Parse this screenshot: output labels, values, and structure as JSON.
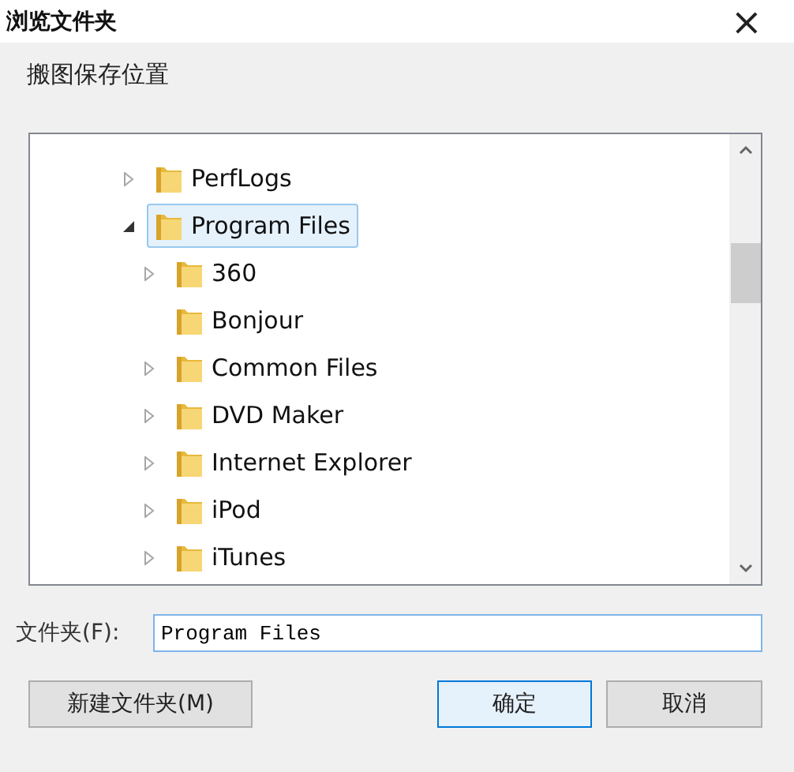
{
  "window": {
    "title": "浏览文件夹",
    "close": "×"
  },
  "description": "搬图保存位置",
  "tree": [
    {
      "label": "PerfLogs",
      "expandable": true,
      "selected": false
    },
    {
      "label": "Program Files",
      "expandable": true,
      "expanded": true,
      "selected": true,
      "children": [
        {
          "label": "360",
          "expandable": true,
          "selected": false
        },
        {
          "label": "Bonjour",
          "expandable": false,
          "selected": false
        },
        {
          "label": "Common Files",
          "expandable": true,
          "selected": false
        },
        {
          "label": "DVD Maker",
          "expandable": true,
          "selected": false
        },
        {
          "label": "Internet Explorer",
          "expandable": true,
          "selected": false
        },
        {
          "label": "iPod",
          "expandable": true,
          "selected": false
        },
        {
          "label": "iTunes",
          "expandable": true,
          "selected": false
        }
      ]
    }
  ],
  "folder_field": {
    "label": "文件夹(F):",
    "value": "Program Files"
  },
  "buttons": [
    {
      "label": "新建文件夹(M)",
      "focused": false
    },
    {
      "label": "确定",
      "focused": true
    },
    {
      "label": "取消",
      "focused": false
    }
  ]
}
